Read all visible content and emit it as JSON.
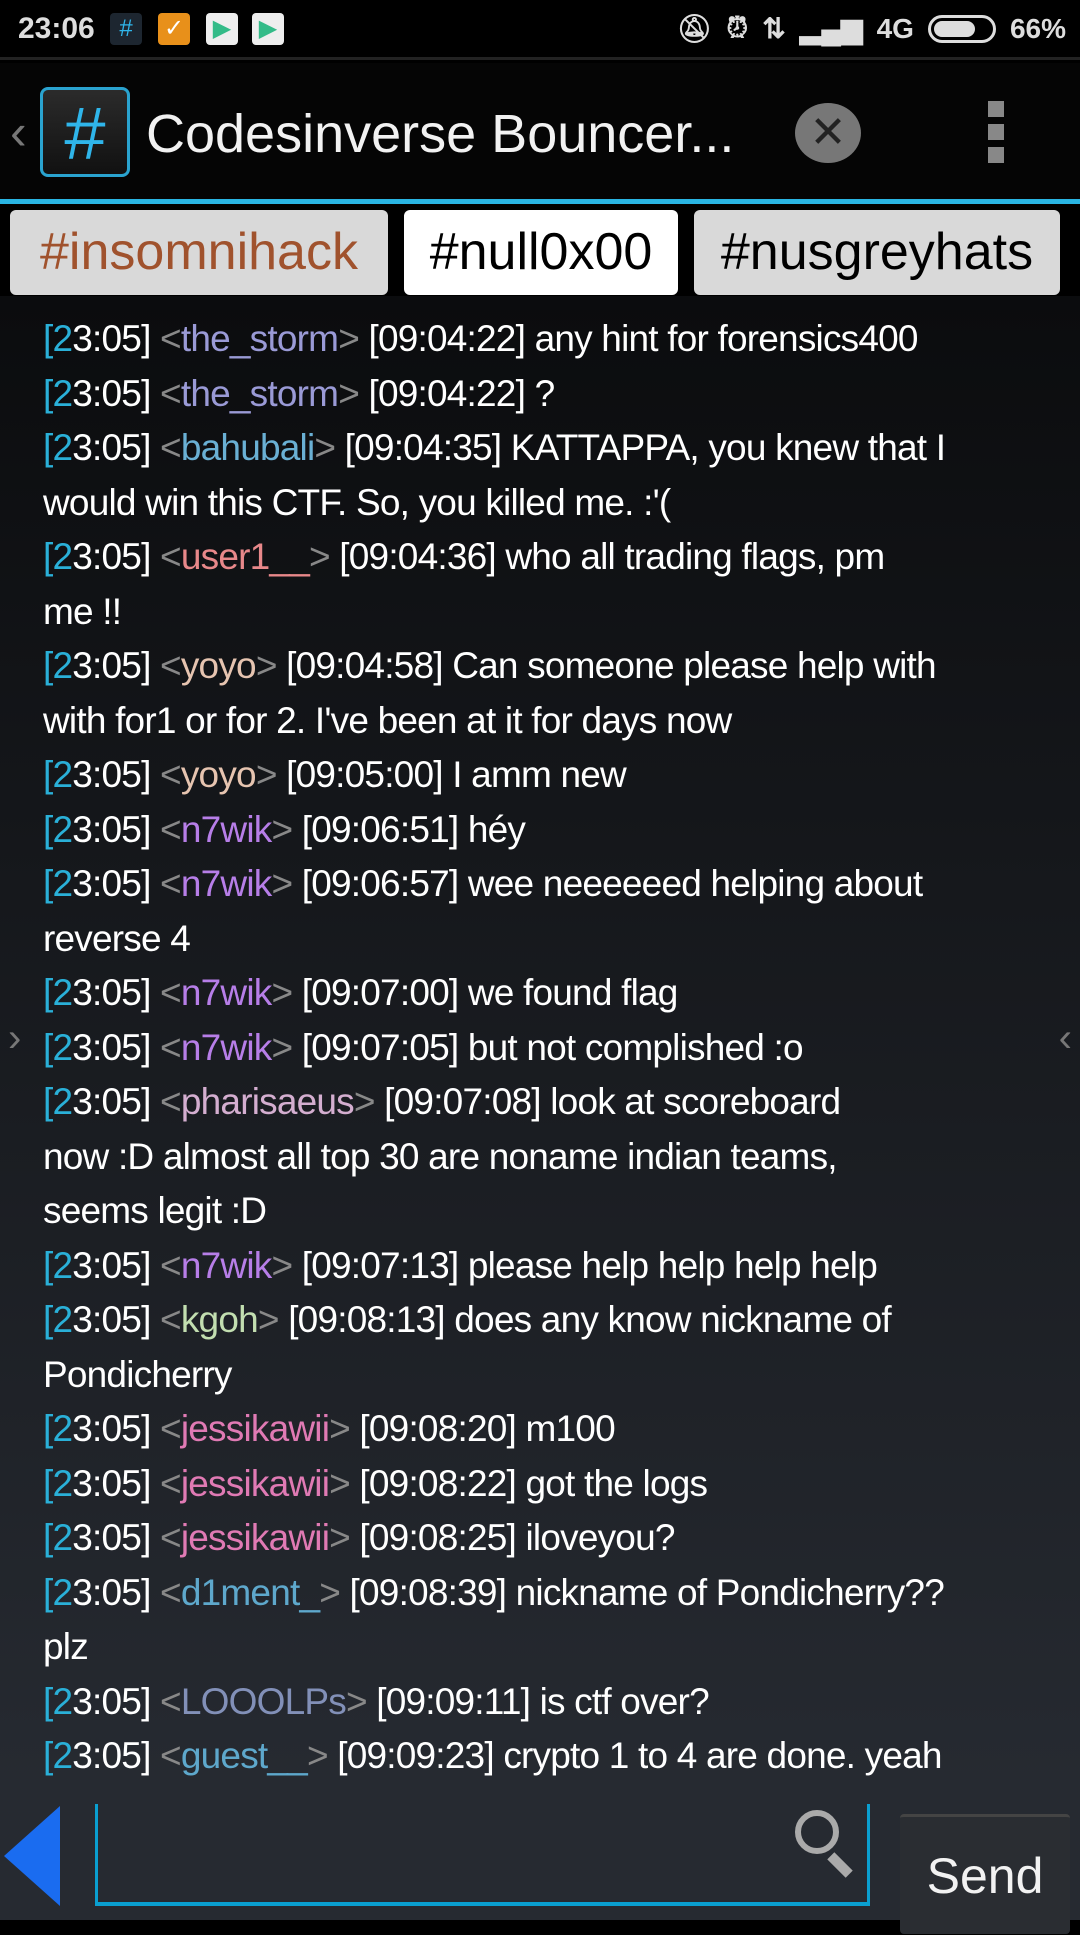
{
  "status_bar": {
    "time": "23:06",
    "battery": "66%",
    "battery_level": 66,
    "network": "4G",
    "icons": [
      "bouncer-hash-icon",
      "launcher-icon",
      "play-store-icon",
      "play-store-icon"
    ]
  },
  "header": {
    "title": "Codesinverse Bouncer..."
  },
  "tabs": [
    {
      "label": "#insomnihack",
      "color": "#a0522d"
    },
    {
      "label": "#null0x00",
      "active": true
    },
    {
      "label": "#nusgreyhats"
    }
  ],
  "messages": [
    {
      "time": "[23:05]",
      "nick": "the_storm",
      "color": "#9a9ad6",
      "stamp": "[09:04:22]",
      "lines": [
        "any hint for forensics400"
      ]
    },
    {
      "time": "[23:05]",
      "nick": "the_storm",
      "color": "#9a9ad6",
      "stamp": "[09:04:22]",
      "lines": [
        "?"
      ]
    },
    {
      "time": "[23:05]",
      "nick": "bahubali",
      "color": "#6ab0d4",
      "stamp": "[09:04:35]",
      "lines": [
        "KATTAPPA, you knew that I",
        "would win this CTF. So, you killed me. :'("
      ]
    },
    {
      "time": "[23:05]",
      "nick": "user1__",
      "color": "#e8888a",
      "stamp": "[09:04:36]",
      "lines": [
        "who all trading flags, pm",
        "me !!"
      ]
    },
    {
      "time": "[23:05]",
      "nick": "yoyo",
      "color": "#e6c4b0",
      "stamp": "[09:04:58]",
      "lines": [
        "Can someone please help with",
        "with for1 or for 2. I've been at it for days now"
      ]
    },
    {
      "time": "[23:05]",
      "nick": "yoyo",
      "color": "#e6c4b0",
      "stamp": "[09:05:00]",
      "lines": [
        "I amm new"
      ]
    },
    {
      "time": "[23:05]",
      "nick": "n7wik",
      "color": "#b77ee8",
      "stamp": "[09:06:51]",
      "lines": [
        "héy"
      ]
    },
    {
      "time": "[23:05]",
      "nick": "n7wik",
      "color": "#b77ee8",
      "stamp": "[09:06:57]",
      "lines": [
        "wee neeeeeed helping about",
        "reverse 4"
      ]
    },
    {
      "time": "[23:05]",
      "nick": "n7wik",
      "color": "#b77ee8",
      "stamp": "[09:07:00]",
      "lines": [
        "we found flag"
      ]
    },
    {
      "time": "[23:05]",
      "nick": "n7wik",
      "color": "#b77ee8",
      "stamp": "[09:07:05]",
      "lines": [
        "but not complished :o"
      ]
    },
    {
      "time": "[23:05]",
      "nick": "pharisaeus",
      "color": "#d4aed0",
      "stamp": "[09:07:08]",
      "lines": [
        "look at scoreboard",
        "now :D almost all top 30 are noname indian teams,",
        "seems legit :D"
      ]
    },
    {
      "time": "[23:05]",
      "nick": "n7wik",
      "color": "#b77ee8",
      "stamp": "[09:07:13]",
      "lines": [
        "please help help help help"
      ]
    },
    {
      "time": "[23:05]",
      "nick": "kgoh",
      "color": "#c2deb0",
      "stamp": "[09:08:13]",
      "lines": [
        "does any know nickname of",
        "Pondicherry"
      ]
    },
    {
      "time": "[23:05]",
      "nick": "jessikawii",
      "color": "#e07ab4",
      "stamp": "[09:08:20]",
      "lines": [
        "m100"
      ]
    },
    {
      "time": "[23:05]",
      "nick": "jessikawii",
      "color": "#e07ab4",
      "stamp": "[09:08:22]",
      "lines": [
        "got the logs"
      ]
    },
    {
      "time": "[23:05]",
      "nick": "jessikawii",
      "color": "#e07ab4",
      "stamp": "[09:08:25]",
      "lines": [
        "iloveyou?"
      ]
    },
    {
      "time": "[23:05]",
      "nick": "d1ment_",
      "color": "#5ea8cc",
      "stamp": "[09:08:39]",
      "lines": [
        "nickname of Pondicherry??",
        "plz"
      ]
    },
    {
      "time": "[23:05]",
      "nick": "LOOOLPs",
      "color": "#8290b8",
      "stamp": "[09:09:11]",
      "lines": [
        "is ctf over?"
      ]
    },
    {
      "time": "[23:05]",
      "nick": "guest__",
      "color": "#5ea8cc",
      "stamp": "[09:09:23]",
      "lines": [
        "crypto 1 to 4 are done. yeah"
      ]
    }
  ],
  "input": {
    "value": "",
    "placeholder": ""
  },
  "send_label": "Send"
}
